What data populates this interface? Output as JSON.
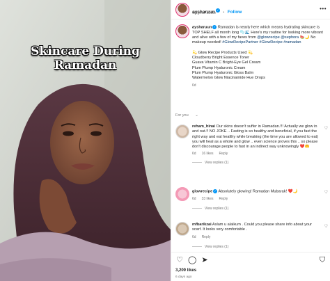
{
  "media": {
    "overlay_title_line1": "Skincare During",
    "overlay_title_line2": "Ramadan"
  },
  "header": {
    "username": "aysharuun",
    "separator": "•",
    "follow_label": "Follow",
    "audio": "Original audio",
    "more_icon": "more-horizontal-icon"
  },
  "caption": {
    "username": "aysharuun",
    "text_part1": "Ramadan is nearly here which means hydrating skincare is TOP SHELF all month long 🫧🌊 Here's my routine for looking more vibrant and alive with a few of my faves from ",
    "mentions": "@glowrecipe @sephora",
    "text_part2": " 🍉🌙 No makeup needed!",
    "hashtags": "#GlowRecipePartner #GlowRecipe #ramadan",
    "products_title": "💫 Glow Recipe Products Used 💫",
    "products": [
      "Cloudberry Bright Essence Toner",
      "Guava Vitamin C Bright-Eye Gel Cream",
      "Plum Plump Hyaluronic Cream",
      "Plum Plump Hyaluronic Gloss Balm",
      "Watermelon Glow Niacinamide Hue Drops"
    ],
    "time": "6d"
  },
  "for_you_label": "For you",
  "comments": [
    {
      "username": "reham_hinai",
      "text": "Our skins doesn't suffer in Ramadan.!!! Actually we glow in and out.!! NO JOKE .. Fasting is so healthy and beneficial, if you fast the right way and eat healthy while breaking (the time you are allowed to eat) you will heal as a whole and glow .. even science proves this .. so please don't discourage people to fast in an indirect way unknowingly ❤️🤲",
      "time": "6d",
      "likes": "16 likes",
      "reply": "Reply",
      "view_replies": "View replies (1)"
    },
    {
      "username": "glowrecipe",
      "text": "Absolutely glowing! Ramadan Mubarak! ❤️🌙",
      "time": "6d",
      "likes": "33 likes",
      "reply": "Reply",
      "view_replies": "View replies (1)"
    },
    {
      "username": "mfbarikzai",
      "text": "Aslam u alaikum . Could you please share info about your scarf. It looks very comfortable .",
      "time": "6d",
      "likes": "",
      "reply": "Reply",
      "view_replies": "View replies (1)"
    }
  ],
  "footer": {
    "likes": "3,209 likes",
    "ago": "6 days ago"
  },
  "colors": {
    "accent": "#0095f6",
    "scarf": "#4a2c35",
    "wall": "#cfd3cc"
  }
}
